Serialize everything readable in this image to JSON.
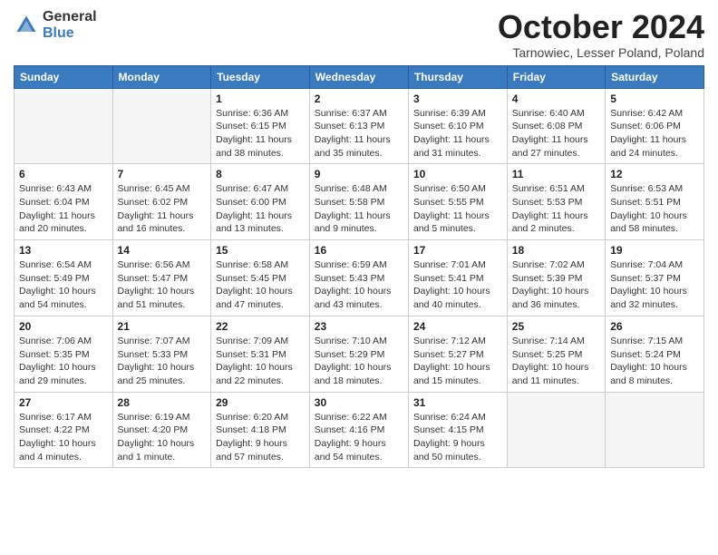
{
  "header": {
    "logo_general": "General",
    "logo_blue": "Blue",
    "month_title": "October 2024",
    "location": "Tarnowiec, Lesser Poland, Poland"
  },
  "days_of_week": [
    "Sunday",
    "Monday",
    "Tuesday",
    "Wednesday",
    "Thursday",
    "Friday",
    "Saturday"
  ],
  "weeks": [
    [
      {
        "num": "",
        "info": ""
      },
      {
        "num": "",
        "info": ""
      },
      {
        "num": "1",
        "info": "Sunrise: 6:36 AM\nSunset: 6:15 PM\nDaylight: 11 hours and 38 minutes."
      },
      {
        "num": "2",
        "info": "Sunrise: 6:37 AM\nSunset: 6:13 PM\nDaylight: 11 hours and 35 minutes."
      },
      {
        "num": "3",
        "info": "Sunrise: 6:39 AM\nSunset: 6:10 PM\nDaylight: 11 hours and 31 minutes."
      },
      {
        "num": "4",
        "info": "Sunrise: 6:40 AM\nSunset: 6:08 PM\nDaylight: 11 hours and 27 minutes."
      },
      {
        "num": "5",
        "info": "Sunrise: 6:42 AM\nSunset: 6:06 PM\nDaylight: 11 hours and 24 minutes."
      }
    ],
    [
      {
        "num": "6",
        "info": "Sunrise: 6:43 AM\nSunset: 6:04 PM\nDaylight: 11 hours and 20 minutes."
      },
      {
        "num": "7",
        "info": "Sunrise: 6:45 AM\nSunset: 6:02 PM\nDaylight: 11 hours and 16 minutes."
      },
      {
        "num": "8",
        "info": "Sunrise: 6:47 AM\nSunset: 6:00 PM\nDaylight: 11 hours and 13 minutes."
      },
      {
        "num": "9",
        "info": "Sunrise: 6:48 AM\nSunset: 5:58 PM\nDaylight: 11 hours and 9 minutes."
      },
      {
        "num": "10",
        "info": "Sunrise: 6:50 AM\nSunset: 5:55 PM\nDaylight: 11 hours and 5 minutes."
      },
      {
        "num": "11",
        "info": "Sunrise: 6:51 AM\nSunset: 5:53 PM\nDaylight: 11 hours and 2 minutes."
      },
      {
        "num": "12",
        "info": "Sunrise: 6:53 AM\nSunset: 5:51 PM\nDaylight: 10 hours and 58 minutes."
      }
    ],
    [
      {
        "num": "13",
        "info": "Sunrise: 6:54 AM\nSunset: 5:49 PM\nDaylight: 10 hours and 54 minutes."
      },
      {
        "num": "14",
        "info": "Sunrise: 6:56 AM\nSunset: 5:47 PM\nDaylight: 10 hours and 51 minutes."
      },
      {
        "num": "15",
        "info": "Sunrise: 6:58 AM\nSunset: 5:45 PM\nDaylight: 10 hours and 47 minutes."
      },
      {
        "num": "16",
        "info": "Sunrise: 6:59 AM\nSunset: 5:43 PM\nDaylight: 10 hours and 43 minutes."
      },
      {
        "num": "17",
        "info": "Sunrise: 7:01 AM\nSunset: 5:41 PM\nDaylight: 10 hours and 40 minutes."
      },
      {
        "num": "18",
        "info": "Sunrise: 7:02 AM\nSunset: 5:39 PM\nDaylight: 10 hours and 36 minutes."
      },
      {
        "num": "19",
        "info": "Sunrise: 7:04 AM\nSunset: 5:37 PM\nDaylight: 10 hours and 32 minutes."
      }
    ],
    [
      {
        "num": "20",
        "info": "Sunrise: 7:06 AM\nSunset: 5:35 PM\nDaylight: 10 hours and 29 minutes."
      },
      {
        "num": "21",
        "info": "Sunrise: 7:07 AM\nSunset: 5:33 PM\nDaylight: 10 hours and 25 minutes."
      },
      {
        "num": "22",
        "info": "Sunrise: 7:09 AM\nSunset: 5:31 PM\nDaylight: 10 hours and 22 minutes."
      },
      {
        "num": "23",
        "info": "Sunrise: 7:10 AM\nSunset: 5:29 PM\nDaylight: 10 hours and 18 minutes."
      },
      {
        "num": "24",
        "info": "Sunrise: 7:12 AM\nSunset: 5:27 PM\nDaylight: 10 hours and 15 minutes."
      },
      {
        "num": "25",
        "info": "Sunrise: 7:14 AM\nSunset: 5:25 PM\nDaylight: 10 hours and 11 minutes."
      },
      {
        "num": "26",
        "info": "Sunrise: 7:15 AM\nSunset: 5:24 PM\nDaylight: 10 hours and 8 minutes."
      }
    ],
    [
      {
        "num": "27",
        "info": "Sunrise: 6:17 AM\nSunset: 4:22 PM\nDaylight: 10 hours and 4 minutes."
      },
      {
        "num": "28",
        "info": "Sunrise: 6:19 AM\nSunset: 4:20 PM\nDaylight: 10 hours and 1 minute."
      },
      {
        "num": "29",
        "info": "Sunrise: 6:20 AM\nSunset: 4:18 PM\nDaylight: 9 hours and 57 minutes."
      },
      {
        "num": "30",
        "info": "Sunrise: 6:22 AM\nSunset: 4:16 PM\nDaylight: 9 hours and 54 minutes."
      },
      {
        "num": "31",
        "info": "Sunrise: 6:24 AM\nSunset: 4:15 PM\nDaylight: 9 hours and 50 minutes."
      },
      {
        "num": "",
        "info": ""
      },
      {
        "num": "",
        "info": ""
      }
    ]
  ]
}
